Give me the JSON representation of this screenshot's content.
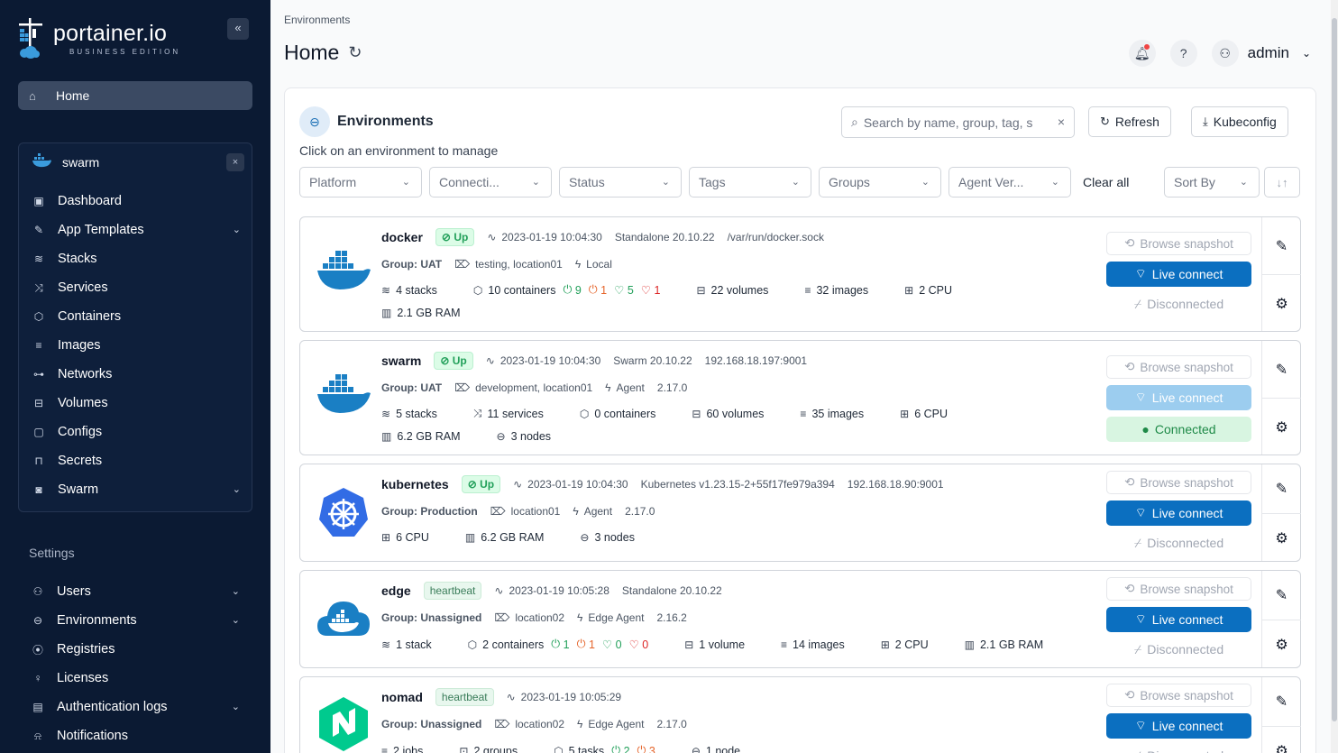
{
  "sidebar": {
    "logo": {
      "main": "portainer.io",
      "sub": "BUSINESS EDITION"
    },
    "collapse_icon": "«",
    "home_label": "Home",
    "env_name": "swarm",
    "env_close": "×",
    "env_items": [
      {
        "label": "Dashboard",
        "icon": "dashboard-icon",
        "glyph": "▣"
      },
      {
        "label": "App Templates",
        "icon": "edit-icon",
        "glyph": "✎",
        "chevron": "⌄"
      },
      {
        "label": "Stacks",
        "icon": "layers-icon",
        "glyph": "≋"
      },
      {
        "label": "Services",
        "icon": "shuffle-icon",
        "glyph": "⤨"
      },
      {
        "label": "Containers",
        "icon": "box-icon",
        "glyph": "⬡"
      },
      {
        "label": "Images",
        "icon": "list-icon",
        "glyph": "≡"
      },
      {
        "label": "Networks",
        "icon": "share-icon",
        "glyph": "⊶"
      },
      {
        "label": "Volumes",
        "icon": "database-icon",
        "glyph": "⊟"
      },
      {
        "label": "Configs",
        "icon": "clipboard-icon",
        "glyph": "▢"
      },
      {
        "label": "Secrets",
        "icon": "lock-icon",
        "glyph": "⊓"
      },
      {
        "label": "Swarm",
        "icon": "swarm-icon",
        "glyph": "◙",
        "chevron": "⌄"
      }
    ],
    "settings_title": "Settings",
    "settings_items": [
      {
        "label": "Users",
        "icon": "users-icon",
        "glyph": "⚇",
        "chevron": "⌄"
      },
      {
        "label": "Environments",
        "icon": "server-icon",
        "glyph": "⊖",
        "chevron": "⌄"
      },
      {
        "label": "Registries",
        "icon": "radio-icon",
        "glyph": "⦿"
      },
      {
        "label": "Licenses",
        "icon": "key-icon",
        "glyph": "♀"
      },
      {
        "label": "Authentication logs",
        "icon": "file-icon",
        "glyph": "▤",
        "chevron": "⌄"
      },
      {
        "label": "Notifications",
        "icon": "bell-icon",
        "glyph": "⍾"
      }
    ]
  },
  "header": {
    "breadcrumb": "Environments",
    "title": "Home",
    "user": "admin"
  },
  "panel": {
    "title": "Environments",
    "subtitle": "Click on an environment to manage",
    "search_placeholder": "Search by name, group, tag, s",
    "refresh_label": "Refresh",
    "kubeconfig_label": "Kubeconfig",
    "filters": [
      "Platform",
      "Connecti...",
      "Status",
      "Tags",
      "Groups",
      "Agent Ver..."
    ],
    "clear_all": "Clear all",
    "sort_by": "Sort By",
    "sort_icon": "↓↑"
  },
  "actions": {
    "browse": "Browse snapshot",
    "live": "Live connect",
    "disconnected": "Disconnected",
    "connected": "Connected"
  },
  "environments": [
    {
      "name": "docker",
      "status": "Up",
      "time": "2023-01-19 10:04:30",
      "platform": "Standalone 20.10.22",
      "url": "/var/run/docker.sock",
      "group": "Group: UAT",
      "tags": "testing, location01",
      "agent": "Local",
      "stacks": "4 stacks",
      "containers": "10 containers",
      "running": "9",
      "stopped": "1",
      "healthy": "5",
      "unhealthy": "1",
      "volumes": "22 volumes",
      "images": "32 images",
      "cpu": "2 CPU",
      "ram": "2.1 GB RAM"
    },
    {
      "name": "swarm",
      "status": "Up",
      "time": "2023-01-19 10:04:30",
      "platform": "Swarm 20.10.22",
      "url": "192.168.18.197:9001",
      "group": "Group: UAT",
      "tags": "development, location01",
      "agent": "Agent",
      "agent_version": "2.17.0",
      "stacks": "5 stacks",
      "services": "11 services",
      "containers": "0 containers",
      "volumes": "60 volumes",
      "images": "35 images",
      "cpu": "6 CPU",
      "ram": "6.2 GB RAM",
      "nodes": "3 nodes"
    },
    {
      "name": "kubernetes",
      "status": "Up",
      "time": "2023-01-19 10:04:30",
      "platform": "Kubernetes v1.23.15-2+55f17fe979a394",
      "url": "192.168.18.90:9001",
      "group": "Group: Production",
      "tags": "location01",
      "agent": "Agent",
      "agent_version": "2.17.0",
      "cpu": "6 CPU",
      "ram": "6.2 GB RAM",
      "nodes": "3 nodes"
    },
    {
      "name": "edge",
      "status": "heartbeat",
      "time": "2023-01-19 10:05:28",
      "platform": "Standalone 20.10.22",
      "group": "Group: Unassigned",
      "tags": "location02",
      "agent": "Edge Agent",
      "agent_version": "2.16.2",
      "stacks": "1 stack",
      "containers": "2 containers",
      "running": "1",
      "stopped": "1",
      "healthy": "0",
      "unhealthy": "0",
      "volumes": "1 volume",
      "images": "14 images",
      "cpu": "2 CPU",
      "ram": "2.1 GB RAM"
    },
    {
      "name": "nomad",
      "status": "heartbeat",
      "time": "2023-01-19 10:05:29",
      "group": "Group: Unassigned",
      "tags": "location02",
      "agent": "Edge Agent",
      "agent_version": "2.17.0",
      "jobs": "2 jobs",
      "groups": "2 groups",
      "tasks": "5 tasks",
      "running": "2",
      "stopped": "3",
      "nodes": "1 node"
    }
  ],
  "colors": {
    "sidebar": "#0b1a33",
    "primary": "#0b6fc0",
    "up": "#22a05a"
  }
}
